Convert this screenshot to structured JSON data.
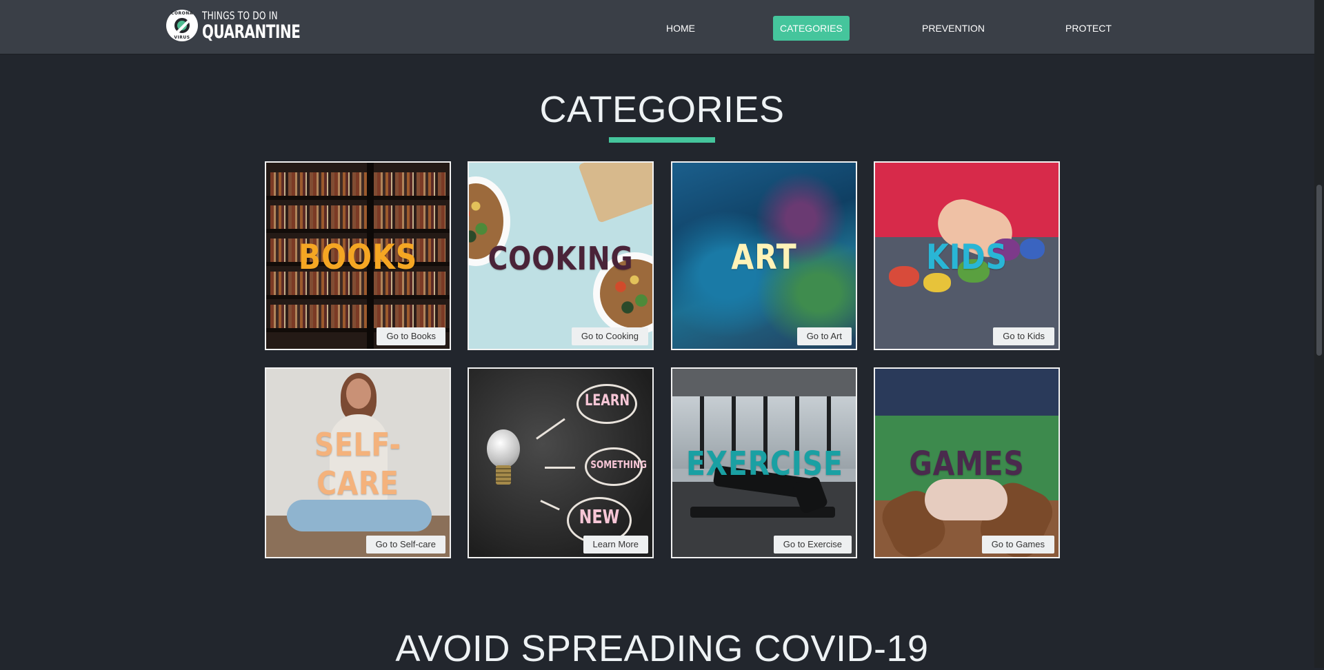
{
  "site": {
    "logo_line1": "THINGS TO DO IN",
    "logo_line2": "QUARANTINE",
    "logo_badge_top": "CORONA",
    "logo_badge_bottom": "VIRUS"
  },
  "nav": {
    "items": [
      {
        "label": "HOME",
        "active": false
      },
      {
        "label": "CATEGORIES",
        "active": true
      },
      {
        "label": "PREVENTION",
        "active": false
      },
      {
        "label": "PROTECT",
        "active": false
      }
    ]
  },
  "categories_section": {
    "title": "CATEGORIES",
    "cards": [
      {
        "label": "BOOKS",
        "label_color": "#f5a623",
        "button": "Go to Books"
      },
      {
        "label": "COOKING",
        "label_color": "#4a2338",
        "button": "Go to Cooking"
      },
      {
        "label": "ART",
        "label_color": "#fff3b8",
        "button": "Go to Art"
      },
      {
        "label": "KIDS",
        "label_color": "#29b6d6",
        "button": "Go to Kids"
      },
      {
        "label_line1": "SELF-",
        "label_line2": "CARE",
        "label_color": "#f4b27c",
        "button": "Go to Self-care"
      },
      {
        "words": [
          "LEARN",
          "SOMETHING",
          "NEW"
        ],
        "label_color": "#f7c6d6",
        "button": "Learn More"
      },
      {
        "label": "EXERCISE",
        "label_color": "#1aa0a3",
        "button": "Go to Exercise"
      },
      {
        "label": "GAMES",
        "label_color": "#4a2a4d",
        "button": "Go to Games"
      }
    ]
  },
  "prevention_section": {
    "title": "AVOID SPREADING COVID-19"
  },
  "colors": {
    "background": "#22262d",
    "navbar": "#3a3f47",
    "accent": "#45c59c"
  }
}
